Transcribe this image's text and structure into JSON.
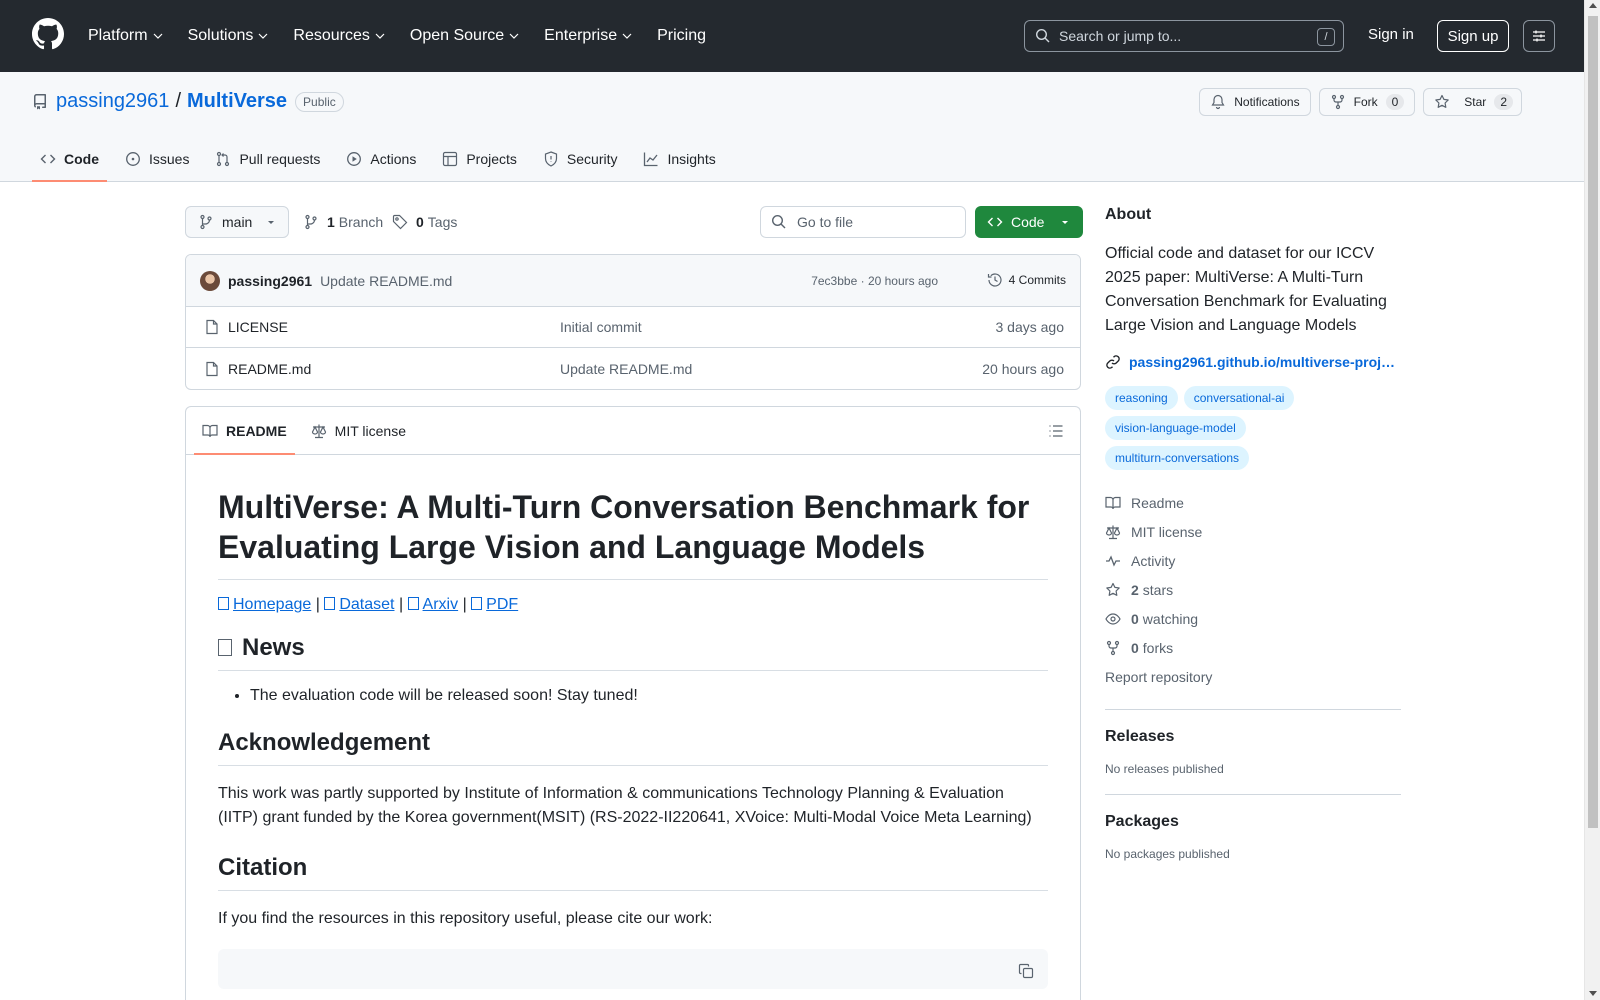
{
  "header": {
    "nav": [
      {
        "label": "Platform",
        "dropdown": true
      },
      {
        "label": "Solutions",
        "dropdown": true
      },
      {
        "label": "Resources",
        "dropdown": true
      },
      {
        "label": "Open Source",
        "dropdown": true
      },
      {
        "label": "Enterprise",
        "dropdown": true
      },
      {
        "label": "Pricing",
        "dropdown": false
      }
    ],
    "search_placeholder": "Search or jump to...",
    "search_key": "/",
    "sign_in": "Sign in",
    "sign_up": "Sign up"
  },
  "repo": {
    "owner": "passing2961",
    "separator": "/",
    "name": "MultiVerse",
    "visibility": "Public",
    "notifications_label": "Notifications",
    "fork_label": "Fork",
    "fork_count": "0",
    "star_label": "Star",
    "star_count": "2",
    "tabs": [
      {
        "label": "Code",
        "icon": "code-icon"
      },
      {
        "label": "Issues",
        "icon": "issue-icon"
      },
      {
        "label": "Pull requests",
        "icon": "pull-request-icon"
      },
      {
        "label": "Actions",
        "icon": "play-icon"
      },
      {
        "label": "Projects",
        "icon": "table-icon"
      },
      {
        "label": "Security",
        "icon": "shield-icon"
      },
      {
        "label": "Insights",
        "icon": "graph-icon"
      }
    ],
    "active_tab": "Code"
  },
  "filenav": {
    "branch": "main",
    "branch_count": "1",
    "branch_label": "Branch",
    "tag_count": "0",
    "tag_label": "Tags",
    "goto_placeholder": "Go to file",
    "code_button": "Code"
  },
  "commit": {
    "author": "passing2961",
    "message": "Update README.md",
    "hash": "7ec3bbe",
    "meta_sep": "·",
    "time": "20 hours ago",
    "count": "4 Commits"
  },
  "files": [
    {
      "name": "LICENSE",
      "message": "Initial commit",
      "date": "3 days ago"
    },
    {
      "name": "README.md",
      "message": "Update README.md",
      "date": "20 hours ago"
    }
  ],
  "readme": {
    "tabs": [
      "README",
      "MIT license"
    ],
    "title": "MultiVerse: A Multi-Turn Conversation Benchmark for Evaluating Large Vision and Language Models",
    "links": [
      "Homepage",
      "Dataset",
      "Arxiv",
      "PDF"
    ],
    "link_sep": "|",
    "news_heading": "News",
    "news_items": [
      "The evaluation code will be released soon! Stay tuned!"
    ],
    "ack_heading": "Acknowledgement",
    "ack_text": "This work was partly supported by Institute of Information & communications Technology Planning & Evaluation (IITP) grant funded by the Korea government(MSIT) (RS-2022-II220641, XVoice: Multi-Modal Voice Meta Learning)",
    "citation_heading": "Citation",
    "citation_text": "If you find the resources in this repository useful, please cite our work:"
  },
  "about": {
    "heading": "About",
    "description": "Official code and dataset for our ICCV 2025 paper: MultiVerse: A Multi-Turn Conversation Benchmark for Evaluating Large Vision and Language Models",
    "website": "passing2961.github.io/multiverse-proj…",
    "topics": [
      "reasoning",
      "conversational-ai",
      "vision-language-model",
      "multiturn-conversations"
    ],
    "readme": "Readme",
    "license": "MIT license",
    "activity": "Activity",
    "stars_count": "2",
    "stars_label": "stars",
    "watching_count": "0",
    "watching_label": "watching",
    "forks_count": "0",
    "forks_label": "forks",
    "report": "Report repository"
  },
  "releases": {
    "heading": "Releases",
    "note": "No releases published"
  },
  "packages": {
    "heading": "Packages",
    "note": "No packages published"
  },
  "colors": {
    "header_bg": "#24292f",
    "link": "#0969da",
    "code_button": "#1f883d",
    "active_tab_underline": "#fd8c73",
    "topic_bg": "#ddf4ff"
  }
}
